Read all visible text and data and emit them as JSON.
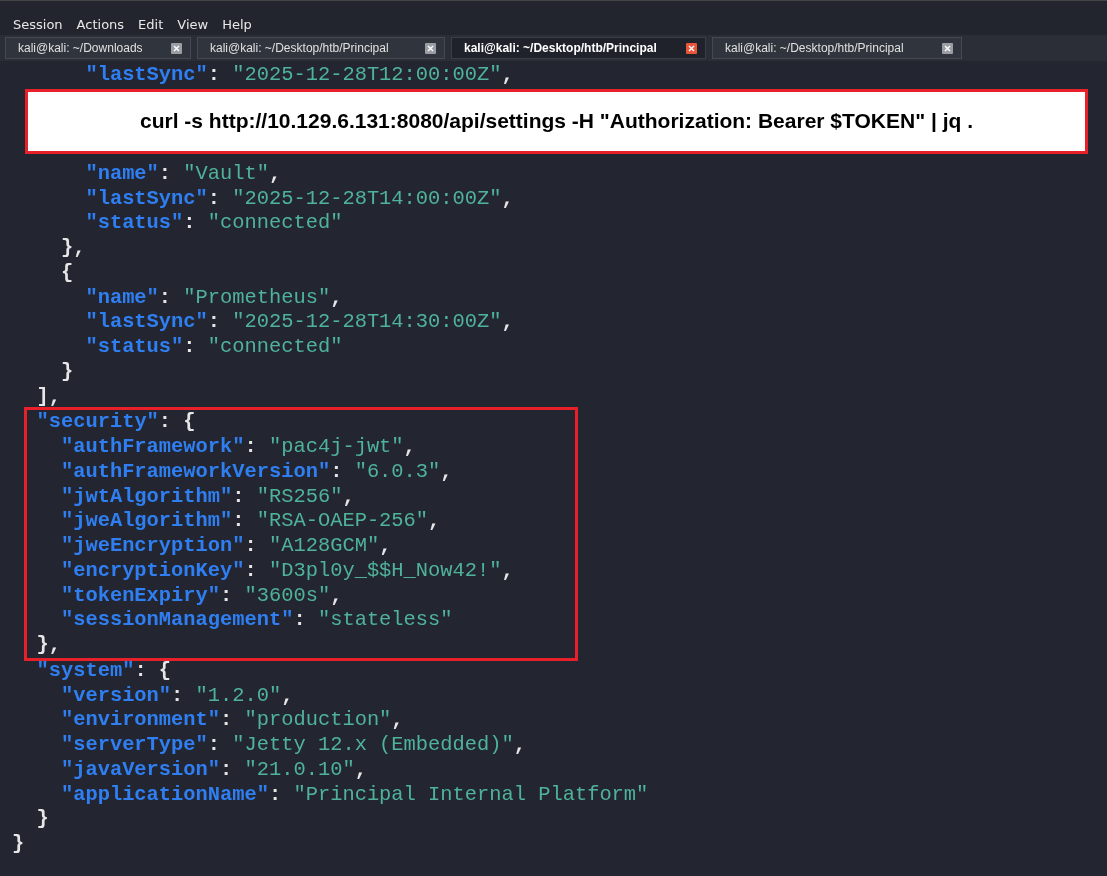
{
  "menu": [
    "Session",
    "Actions",
    "Edit",
    "View",
    "Help"
  ],
  "tabs": [
    {
      "label": "kali@kali: ~/Downloads",
      "selected": false
    },
    {
      "label": "kali@kali: ~/Desktop/htb/Principal",
      "selected": false
    },
    {
      "label": "kali@kali: ~/Desktop/htb/Principal",
      "selected": true
    },
    {
      "label": "kali@kali: ~/Desktop/htb/Principal",
      "selected": false
    }
  ],
  "terminal": {
    "lines_top": [
      "      \"lastSync\": \"2025-12-28T12:00:00Z\","
    ],
    "annotation": {
      "command": "curl -s http://10.129.6.131:8080/api/settings -H \"Authorization: Bearer $TOKEN\" | jq ."
    },
    "lines_middle": [
      "      \"name\": \"Vault\",",
      "      \"lastSync\": \"2025-12-28T14:00:00Z\",",
      "      \"status\": \"connected\"",
      "    },",
      "    {",
      "      \"name\": \"Prometheus\",",
      "      \"lastSync\": \"2025-12-28T14:30:00Z\",",
      "      \"status\": \"connected\"",
      "    }",
      "  ],"
    ],
    "highlighted_block": [
      "  \"security\": {",
      "    \"authFramework\": \"pac4j-jwt\",",
      "    \"authFrameworkVersion\": \"6.0.3\",",
      "    \"jwtAlgorithm\": \"RS256\",",
      "    \"jweAlgorithm\": \"RSA-OAEP-256\",",
      "    \"jweEncryption\": \"A128GCM\",",
      "    \"encryptionKey\": \"D3pl0y_$$H_Now42!\",",
      "    \"tokenExpiry\": \"3600s\",",
      "    \"sessionManagement\": \"stateless\"",
      "  },"
    ],
    "lines_bottom": [
      "  \"system\": {",
      "    \"version\": \"1.2.0\",",
      "    \"environment\": \"production\",",
      "    \"serverType\": \"Jetty 12.x (Embedded)\",",
      "    \"javaVersion\": \"21.0.10\",",
      "    \"applicationName\": \"Principal Internal Platform\"",
      "  }",
      "}"
    ]
  }
}
